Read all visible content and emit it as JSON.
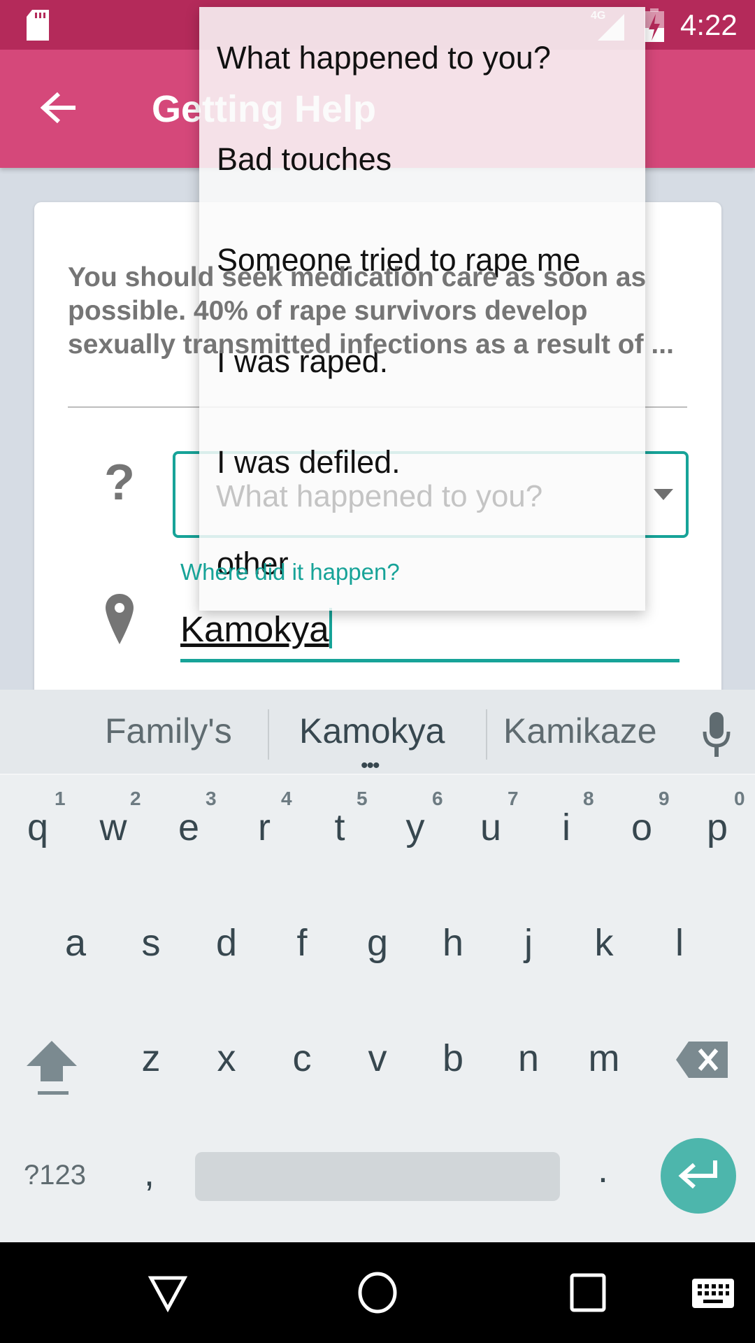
{
  "status_bar": {
    "time": "4:22",
    "network": "4G",
    "icons": [
      "sd-card-icon",
      "signal-icon",
      "battery-charging-icon"
    ]
  },
  "app_bar": {
    "title": "Getting Help",
    "back_icon": "arrow-left-icon"
  },
  "card": {
    "info_text": "You should seek medication care as soon as possible. 40% of rape survivors develop sexually transmitted infections as a result of ...",
    "spinner": {
      "icon": "question-icon",
      "placeholder": "What happened to you?"
    },
    "location": {
      "icon": "map-pin-icon",
      "label": "Where did it happen?",
      "value": "Kamokya"
    }
  },
  "dropdown": {
    "options": [
      "What happened to you?",
      "Bad touches",
      "Someone tried to rape me",
      "I was raped.",
      "I was defiled.",
      "other"
    ]
  },
  "keyboard": {
    "suggestions": [
      "Family's",
      "Kamokya",
      "Kamikaze"
    ],
    "row1": [
      "q",
      "w",
      "e",
      "r",
      "t",
      "y",
      "u",
      "i",
      "o",
      "p"
    ],
    "row1_hints": [
      "1",
      "2",
      "3",
      "4",
      "5",
      "6",
      "7",
      "8",
      "9",
      "0"
    ],
    "row2": [
      "a",
      "s",
      "d",
      "f",
      "g",
      "h",
      "j",
      "k",
      "l"
    ],
    "row3": [
      "z",
      "x",
      "c",
      "v",
      "b",
      "n",
      "m"
    ],
    "symbols_label": "?123",
    "comma": ",",
    "period": ".",
    "accent": "#4db6ac"
  },
  "colors": {
    "status_bar": "#b42a5a",
    "app_bar": "#d5487a",
    "accent": "#17a398"
  }
}
